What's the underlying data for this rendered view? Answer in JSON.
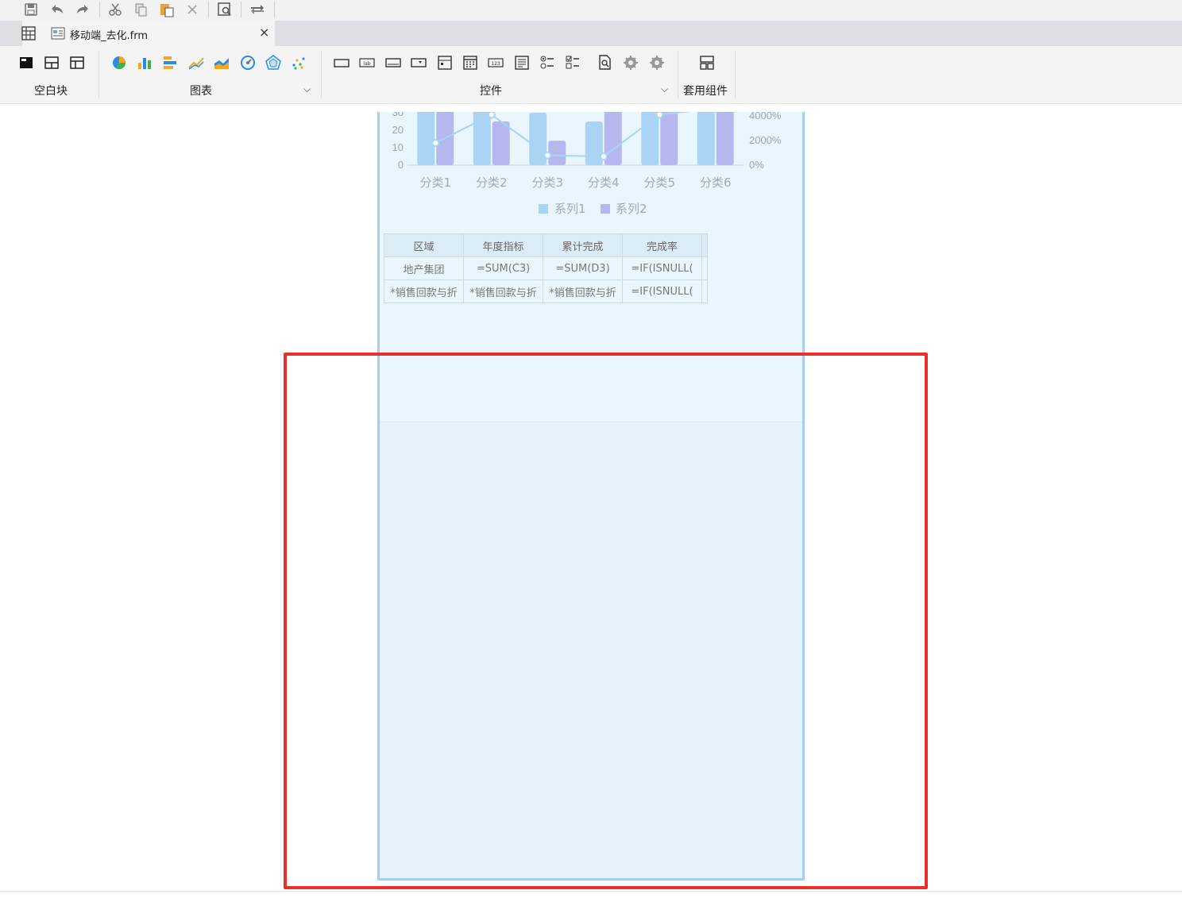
{
  "tab": {
    "title": "移动端_去化.frm",
    "close_label": "×"
  },
  "ribbon": {
    "groups": [
      {
        "label": "空白块"
      },
      {
        "label": "图表"
      },
      {
        "label": "控件"
      },
      {
        "label": "套用组件"
      }
    ],
    "dropdown_glyph": "⌵"
  },
  "quickbar_icons": [
    "save-icon",
    "undo-icon",
    "redo-icon",
    "cut-icon",
    "copy-icon",
    "paste-icon",
    "delete-icon",
    "preview-icon",
    "switch-icon"
  ],
  "colors": {
    "accent": "#a7cdf0",
    "highlight": "#e8302a",
    "series1": "#a9d4f5",
    "series2": "#b5b8ef"
  },
  "chart_data": {
    "type": "bar",
    "categories": [
      "分类1",
      "分类2",
      "分类3",
      "分类4",
      "分类5",
      "分类6"
    ],
    "y_ticks": [
      "0",
      "10",
      "20",
      "30"
    ],
    "y2_ticks": [
      "0%",
      "2000%",
      "4000%"
    ],
    "legend": [
      "系列1",
      "系列2"
    ],
    "series": [
      {
        "name": "系列1",
        "values": [
          32,
          34,
          30,
          25,
          33,
          35
        ]
      },
      {
        "name": "系列2",
        "values": [
          31,
          25,
          14,
          33,
          34,
          34
        ]
      }
    ],
    "line_values_pct": [
      1800,
      4100,
      800,
      700,
      4100,
      4600
    ]
  },
  "report_table": {
    "headers": [
      "区域",
      "年度指标",
      "累计完成",
      "完成率"
    ],
    "rows": [
      [
        "地产集团",
        "=SUM(C3)",
        "=SUM(D3)",
        "=IF(ISNULL("
      ],
      [
        "*销售回款与折",
        "*销售回款与折",
        "*销售回款与折",
        "=IF(ISNULL("
      ]
    ]
  }
}
